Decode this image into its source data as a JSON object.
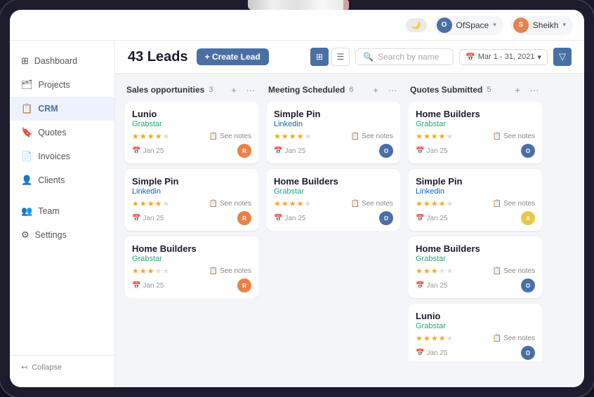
{
  "pencil": {
    "label": "Apple Pencil"
  },
  "topbar": {
    "moon_icon": "🌙",
    "user1": {
      "name": "OfSpace",
      "initial": "O",
      "color": "#4a6fa5"
    },
    "user2": {
      "name": "Sheikh",
      "initial": "S",
      "color": "#e8824a"
    }
  },
  "sidebar": {
    "items": [
      {
        "id": "dashboard",
        "label": "Dashboard",
        "icon": "⊞",
        "active": false
      },
      {
        "id": "projects",
        "label": "Projects",
        "icon": "🗂",
        "active": false
      },
      {
        "id": "crm",
        "label": "CRM",
        "icon": "📋",
        "active": true
      },
      {
        "id": "quotes",
        "label": "Quotes",
        "icon": "🔖",
        "active": false
      },
      {
        "id": "invoices",
        "label": "Invoices",
        "icon": "📄",
        "active": false
      },
      {
        "id": "clients",
        "label": "Clients",
        "icon": "👤",
        "active": false
      },
      {
        "id": "team",
        "label": "Team",
        "icon": "👥",
        "active": false
      },
      {
        "id": "settings",
        "label": "Settings",
        "icon": "⚙",
        "active": false
      }
    ],
    "collapse_label": "Collapse"
  },
  "header": {
    "title": "43 Leads",
    "create_btn": "+ Create Lead",
    "view_grid_icon": "⊞",
    "view_list_icon": "☰",
    "search_placeholder": "Search by name",
    "date_range": "Mar 1 - 31, 2021",
    "filter_icon": "▽"
  },
  "columns": [
    {
      "id": "sales-opportunities",
      "title": "Sales opportunities",
      "count": 3,
      "cards": [
        {
          "company": "Lunio",
          "source": "Grabstar",
          "source_type": "grabstar",
          "stars": 4,
          "date": "Jan 25",
          "avatar_color": "#e8824a",
          "avatar_initial": "R"
        },
        {
          "company": "Simple Pin",
          "source": "Linkedin",
          "source_type": "linkedin",
          "stars": 4,
          "date": "Jan 25",
          "avatar_color": "#e8824a",
          "avatar_initial": "R"
        },
        {
          "company": "Home Builders",
          "source": "Grabstar",
          "source_type": "grabstar",
          "stars": 3,
          "date": "Jan 25",
          "avatar_color": "#e8824a",
          "avatar_initial": "R"
        }
      ]
    },
    {
      "id": "meeting-scheduled",
      "title": "Meeting Scheduled",
      "count": 6,
      "cards": [
        {
          "company": "Simple Pin",
          "source": "Linkedin",
          "source_type": "linkedin",
          "stars": 4,
          "date": "Jan 25",
          "avatar_color": "#4a6fa5",
          "avatar_initial": "O"
        },
        {
          "company": "Home Builders",
          "source": "Grabstar",
          "source_type": "grabstar",
          "stars": 4,
          "date": "Jan 25",
          "avatar_color": "#4a6fa5",
          "avatar_initial": "O"
        }
      ]
    },
    {
      "id": "quotes-submitted",
      "title": "Quotes Submitted",
      "count": 5,
      "cards": [
        {
          "company": "Home Builders",
          "source": "Grabstar",
          "source_type": "grabstar",
          "stars": 4,
          "date": "Jan 25",
          "avatar_color": "#4a6fa5",
          "avatar_initial": "O"
        },
        {
          "company": "Simple Pin",
          "source": "Linkedin",
          "source_type": "linkedin",
          "stars": 4,
          "date": "Jan 25",
          "avatar_color": "#e8c84a",
          "avatar_initial": "A"
        },
        {
          "company": "Home Builders",
          "source": "Grabstar",
          "source_type": "grabstar",
          "stars": 3,
          "date": "Jan 25",
          "avatar_color": "#4a6fa5",
          "avatar_initial": "O"
        },
        {
          "company": "Lunio",
          "source": "Grabstar",
          "source_type": "grabstar",
          "stars": 4,
          "date": "Jan 25",
          "avatar_color": "#4a6fa5",
          "avatar_initial": "O"
        }
      ]
    }
  ],
  "see_notes_label": "See notes",
  "calendar_icon": "📅"
}
